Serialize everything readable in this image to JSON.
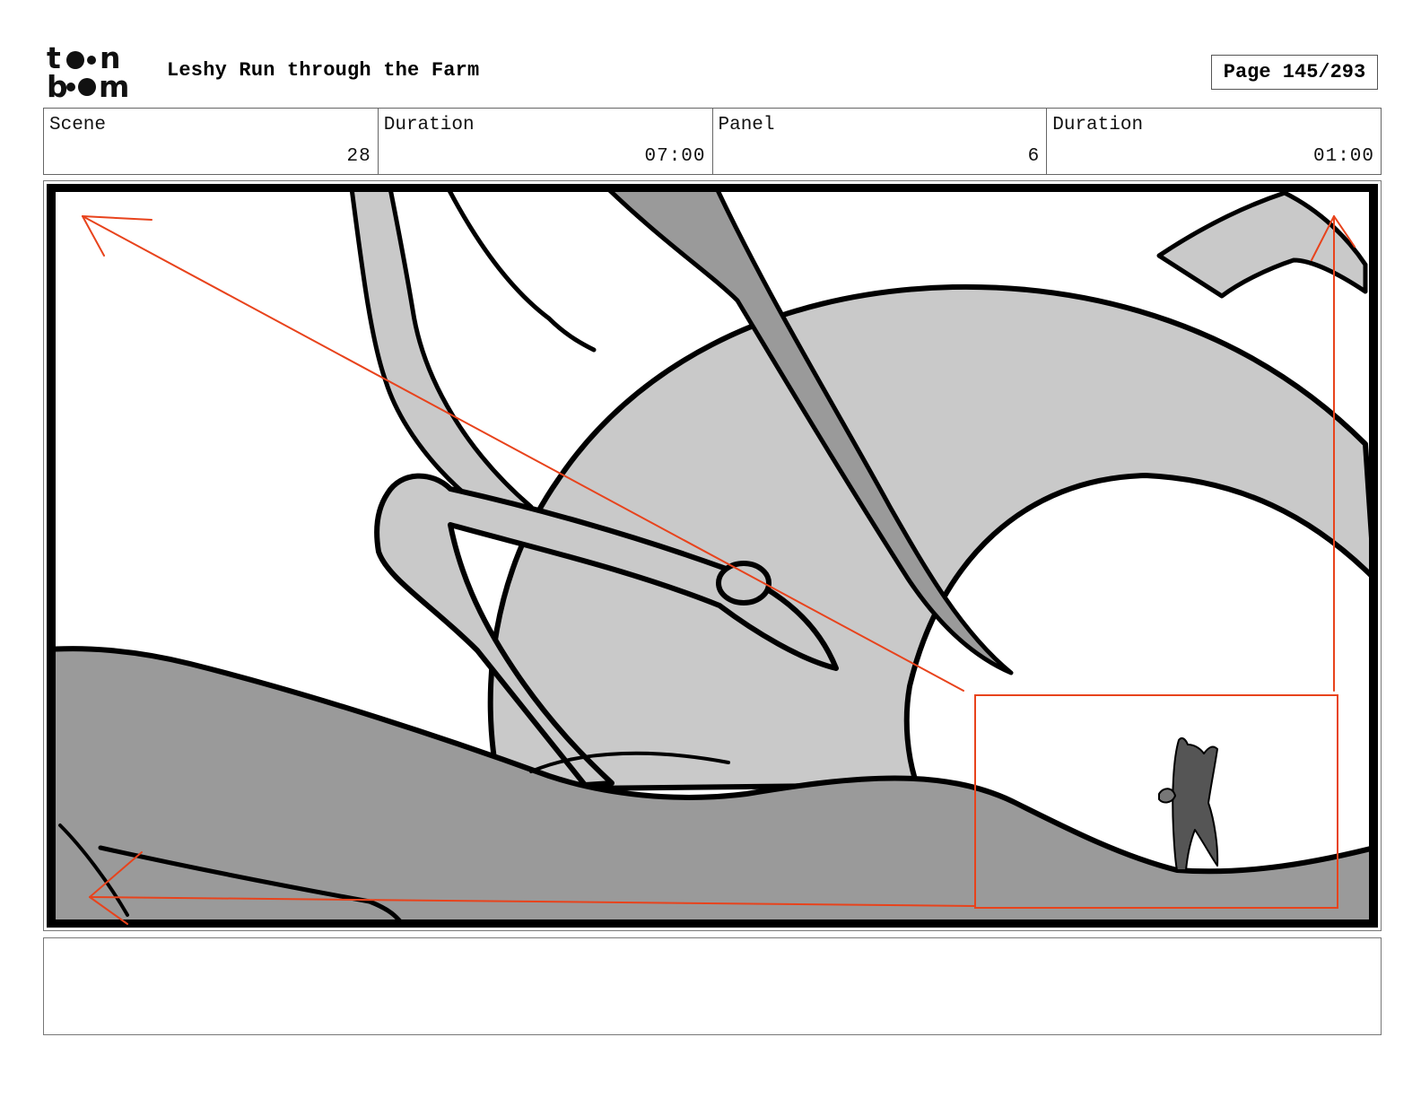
{
  "header": {
    "logo_top": "to•n",
    "logo_bottom": "b••m",
    "project_title": "Leshy Run through the Farm",
    "page_label": "Page 145/293"
  },
  "info": {
    "scene_label": "Scene",
    "scene_value": "28",
    "scene_duration_label": "Duration",
    "scene_duration_value": "07:00",
    "panel_label": "Panel",
    "panel_value": "6",
    "panel_duration_label": "Duration",
    "panel_duration_value": "01:00"
  },
  "notes": {
    "text": ""
  },
  "colors": {
    "camera_move": "#e8431c",
    "light_fill": "#c9c9c9",
    "mid_fill": "#9a9a9a",
    "ink": "#000000"
  }
}
